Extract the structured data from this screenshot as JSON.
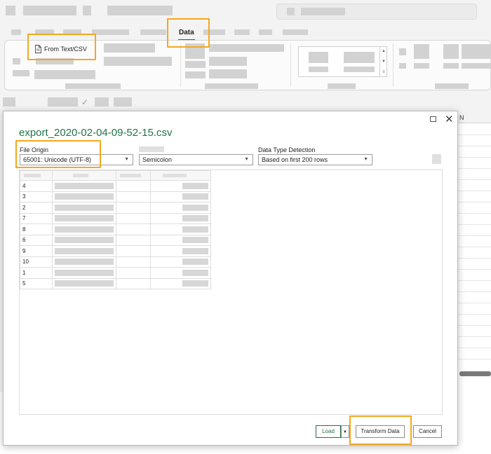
{
  "ribbon": {
    "data_tab_label": "Data",
    "from_text_csv_label": "From Text/CSV"
  },
  "dialog": {
    "filename": "export_2020-02-04-09-52-15.csv",
    "file_origin_label": "File Origin",
    "file_origin_value": "65001: Unicode (UTF-8)",
    "delimiter_value": "Semicolon",
    "data_type_detection_label": "Data Type Detection",
    "data_type_detection_value": "Based on first 200 rows",
    "preview_rows": [
      {
        "id": "4"
      },
      {
        "id": "3"
      },
      {
        "id": "2"
      },
      {
        "id": "7"
      },
      {
        "id": "8"
      },
      {
        "id": "6"
      },
      {
        "id": "9"
      },
      {
        "id": "10"
      },
      {
        "id": "1"
      },
      {
        "id": "5"
      }
    ],
    "load_label": "Load",
    "transform_data_label": "Transform Data",
    "cancel_label": "Cancel"
  },
  "sheet": {
    "column_header_partial": "N"
  },
  "colors": {
    "accent_green": "#217346",
    "highlight": "#f4a81d"
  }
}
